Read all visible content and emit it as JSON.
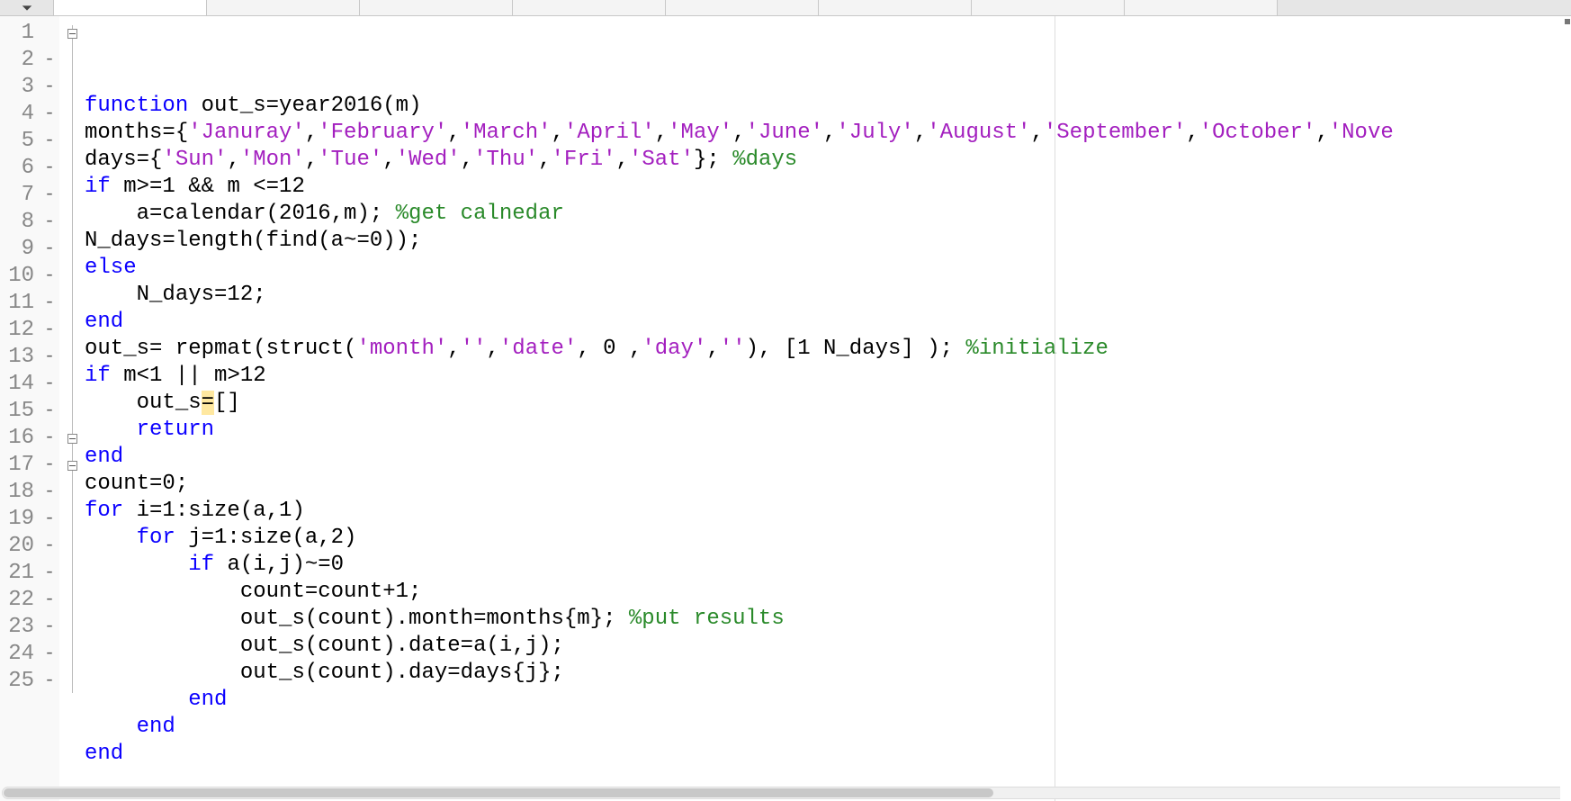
{
  "tabs": [
    {
      "label": ""
    },
    {
      "label": ""
    },
    {
      "label": ""
    },
    {
      "label": ""
    },
    {
      "label": ""
    },
    {
      "label": ""
    },
    {
      "label": ""
    },
    {
      "label": ""
    }
  ],
  "lines": [
    {
      "num": "1",
      "marker": "",
      "fold": "open",
      "tokens": [
        {
          "t": "cursor",
          "v": ""
        },
        {
          "t": "kw",
          "v": "function "
        },
        {
          "t": "",
          "v": "out_s=year2016(m)"
        }
      ]
    },
    {
      "num": "2",
      "marker": "-",
      "fold": "",
      "tokens": [
        {
          "t": "",
          "v": "months={"
        },
        {
          "t": "str",
          "v": "'Januray'"
        },
        {
          "t": "",
          "v": ","
        },
        {
          "t": "str",
          "v": "'February'"
        },
        {
          "t": "",
          "v": ","
        },
        {
          "t": "str",
          "v": "'March'"
        },
        {
          "t": "",
          "v": ","
        },
        {
          "t": "str",
          "v": "'April'"
        },
        {
          "t": "",
          "v": ","
        },
        {
          "t": "str",
          "v": "'May'"
        },
        {
          "t": "",
          "v": ","
        },
        {
          "t": "str",
          "v": "'June'"
        },
        {
          "t": "",
          "v": ","
        },
        {
          "t": "str",
          "v": "'July'"
        },
        {
          "t": "",
          "v": ","
        },
        {
          "t": "str",
          "v": "'August'"
        },
        {
          "t": "",
          "v": ","
        },
        {
          "t": "str",
          "v": "'September'"
        },
        {
          "t": "",
          "v": ","
        },
        {
          "t": "str",
          "v": "'October'"
        },
        {
          "t": "",
          "v": ","
        },
        {
          "t": "str",
          "v": "'Nove"
        }
      ]
    },
    {
      "num": "3",
      "marker": "-",
      "fold": "",
      "tokens": [
        {
          "t": "",
          "v": "days={"
        },
        {
          "t": "str",
          "v": "'Sun'"
        },
        {
          "t": "",
          "v": ","
        },
        {
          "t": "str",
          "v": "'Mon'"
        },
        {
          "t": "",
          "v": ","
        },
        {
          "t": "str",
          "v": "'Tue'"
        },
        {
          "t": "",
          "v": ","
        },
        {
          "t": "str",
          "v": "'Wed'"
        },
        {
          "t": "",
          "v": ","
        },
        {
          "t": "str",
          "v": "'Thu'"
        },
        {
          "t": "",
          "v": ","
        },
        {
          "t": "str",
          "v": "'Fri'"
        },
        {
          "t": "",
          "v": ","
        },
        {
          "t": "str",
          "v": "'Sat'"
        },
        {
          "t": "",
          "v": "}; "
        },
        {
          "t": "cm",
          "v": "%days"
        }
      ]
    },
    {
      "num": "4",
      "marker": "-",
      "fold": "",
      "tokens": [
        {
          "t": "kw",
          "v": "if "
        },
        {
          "t": "",
          "v": "m>=1 && m <=12"
        }
      ]
    },
    {
      "num": "5",
      "marker": "-",
      "fold": "",
      "tokens": [
        {
          "t": "",
          "v": "    a=calendar(2016,m); "
        },
        {
          "t": "cm",
          "v": "%get calnedar"
        }
      ]
    },
    {
      "num": "6",
      "marker": "-",
      "fold": "",
      "tokens": [
        {
          "t": "",
          "v": "N_days=length(find(a~=0));"
        }
      ]
    },
    {
      "num": "7",
      "marker": "-",
      "fold": "",
      "tokens": [
        {
          "t": "kw",
          "v": "else"
        }
      ]
    },
    {
      "num": "8",
      "marker": "-",
      "fold": "",
      "tokens": [
        {
          "t": "",
          "v": "    N_days=12;"
        }
      ]
    },
    {
      "num": "9",
      "marker": "-",
      "fold": "",
      "tokens": [
        {
          "t": "kw",
          "v": "end"
        }
      ]
    },
    {
      "num": "10",
      "marker": "-",
      "fold": "",
      "tokens": [
        {
          "t": "",
          "v": "out_s= repmat(struct("
        },
        {
          "t": "str",
          "v": "'month'"
        },
        {
          "t": "",
          "v": ","
        },
        {
          "t": "str",
          "v": "''"
        },
        {
          "t": "",
          "v": ","
        },
        {
          "t": "str",
          "v": "'date'"
        },
        {
          "t": "",
          "v": ", 0 ,"
        },
        {
          "t": "str",
          "v": "'day'"
        },
        {
          "t": "",
          "v": ","
        },
        {
          "t": "str",
          "v": "''"
        },
        {
          "t": "",
          "v": "), [1 N_days] ); "
        },
        {
          "t": "cm",
          "v": "%initialize"
        }
      ]
    },
    {
      "num": "11",
      "marker": "-",
      "fold": "",
      "tokens": [
        {
          "t": "kw",
          "v": "if "
        },
        {
          "t": "",
          "v": "m<1 || m>12"
        }
      ]
    },
    {
      "num": "12",
      "marker": "-",
      "fold": "",
      "tokens": [
        {
          "t": "",
          "v": "    out_s"
        },
        {
          "t": "hl",
          "v": "="
        },
        {
          "t": "",
          "v": "[]"
        }
      ]
    },
    {
      "num": "13",
      "marker": "-",
      "fold": "",
      "tokens": [
        {
          "t": "",
          "v": "    "
        },
        {
          "t": "kw",
          "v": "return"
        }
      ]
    },
    {
      "num": "14",
      "marker": "-",
      "fold": "",
      "tokens": [
        {
          "t": "kw",
          "v": "end"
        }
      ]
    },
    {
      "num": "15",
      "marker": "-",
      "fold": "",
      "tokens": [
        {
          "t": "",
          "v": "count=0;"
        }
      ]
    },
    {
      "num": "16",
      "marker": "-",
      "fold": "open",
      "tokens": [
        {
          "t": "kw",
          "v": "for "
        },
        {
          "t": "",
          "v": "i=1:size(a,1)"
        }
      ]
    },
    {
      "num": "17",
      "marker": "-",
      "fold": "open",
      "tokens": [
        {
          "t": "",
          "v": "    "
        },
        {
          "t": "kw",
          "v": "for "
        },
        {
          "t": "",
          "v": "j=1:size(a,2)"
        }
      ]
    },
    {
      "num": "18",
      "marker": "-",
      "fold": "",
      "tokens": [
        {
          "t": "",
          "v": "        "
        },
        {
          "t": "kw",
          "v": "if "
        },
        {
          "t": "",
          "v": "a(i,j)~=0"
        }
      ]
    },
    {
      "num": "19",
      "marker": "-",
      "fold": "",
      "tokens": [
        {
          "t": "",
          "v": "            count=count+1;"
        }
      ]
    },
    {
      "num": "20",
      "marker": "-",
      "fold": "",
      "tokens": [
        {
          "t": "",
          "v": "            out_s(count).month=months{m}; "
        },
        {
          "t": "cm",
          "v": "%put results"
        }
      ]
    },
    {
      "num": "21",
      "marker": "-",
      "fold": "",
      "tokens": [
        {
          "t": "",
          "v": "            out_s(count).date=a(i,j);"
        }
      ]
    },
    {
      "num": "22",
      "marker": "-",
      "fold": "",
      "tokens": [
        {
          "t": "",
          "v": "            out_s(count).day=days{j};"
        }
      ]
    },
    {
      "num": "23",
      "marker": "-",
      "fold": "",
      "tokens": [
        {
          "t": "",
          "v": "        "
        },
        {
          "t": "kw",
          "v": "end"
        }
      ]
    },
    {
      "num": "24",
      "marker": "-",
      "fold": "",
      "tokens": [
        {
          "t": "",
          "v": "    "
        },
        {
          "t": "kw",
          "v": "end"
        }
      ]
    },
    {
      "num": "25",
      "marker": "-",
      "fold": "",
      "tokens": [
        {
          "t": "kw",
          "v": "end"
        }
      ]
    }
  ]
}
